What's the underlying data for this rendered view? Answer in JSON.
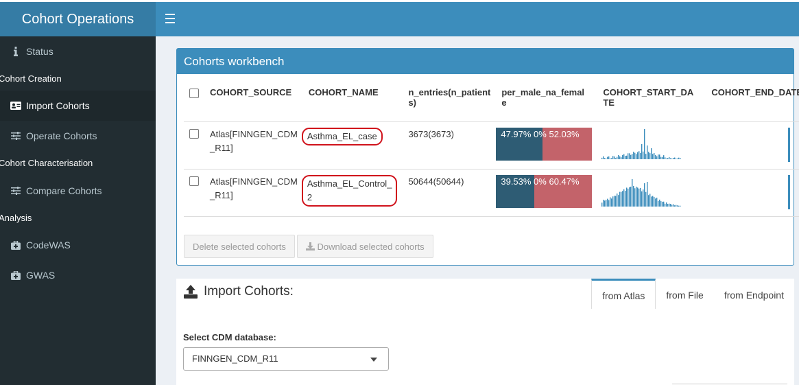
{
  "app": {
    "title": "Cohort Operations"
  },
  "sidebar": {
    "items": [
      {
        "label": "Status",
        "icon": "info-icon"
      },
      {
        "header": "Cohort Creation"
      },
      {
        "label": "Import Cohorts",
        "icon": "id-card-icon",
        "active": true
      },
      {
        "label": "Operate Cohorts",
        "icon": "sliders-icon"
      },
      {
        "header": "Cohort Characterisation"
      },
      {
        "label": "Compare Cohorts",
        "icon": "sliders-icon"
      },
      {
        "header": "Analysis"
      },
      {
        "label": "CodeWAS",
        "icon": "medkit-icon"
      },
      {
        "label": "GWAS",
        "icon": "medkit-icon"
      }
    ]
  },
  "workbench": {
    "title": "Cohorts workbench",
    "columns": [
      "COHORT_SOURCE",
      "COHORT_NAME",
      "n_entries(n_patient\ns)",
      "per_male_na_femal\ne",
      "COHORT_START_DA\nTE",
      "COHORT_END_DATE"
    ],
    "rows": [
      {
        "source": "Atlas[FINNGEN_CDM\n_R11]",
        "name": "Asthma_EL_case",
        "entries": "3673(3673)",
        "male_pct": 47.97,
        "na_pct": 0,
        "female_pct": 52.03,
        "sex_label": "47.97% 0% 52.03%"
      },
      {
        "source": "Atlas[FINNGEN_CDM\n_R11]",
        "name": "Asthma_EL_Control_\n2",
        "entries": "50644(50644)",
        "male_pct": 39.53,
        "na_pct": 0,
        "female_pct": 60.47,
        "sex_label": "39.53% 0% 60.47%"
      }
    ],
    "buttons": {
      "delete": "Delete selected cohorts",
      "download": "Download selected cohorts"
    },
    "colors": {
      "male": "#2e5c74",
      "female": "#c3636a",
      "accent": "#3c8dbc",
      "circle": "#d0121b"
    }
  },
  "import": {
    "title": "Import Cohorts:",
    "tabs": [
      "from Atlas",
      "from File",
      "from Endpoint"
    ],
    "active_tab": "from Atlas",
    "select_label": "Select CDM database:",
    "select_value": "FINNGEN_CDM_R11"
  }
}
